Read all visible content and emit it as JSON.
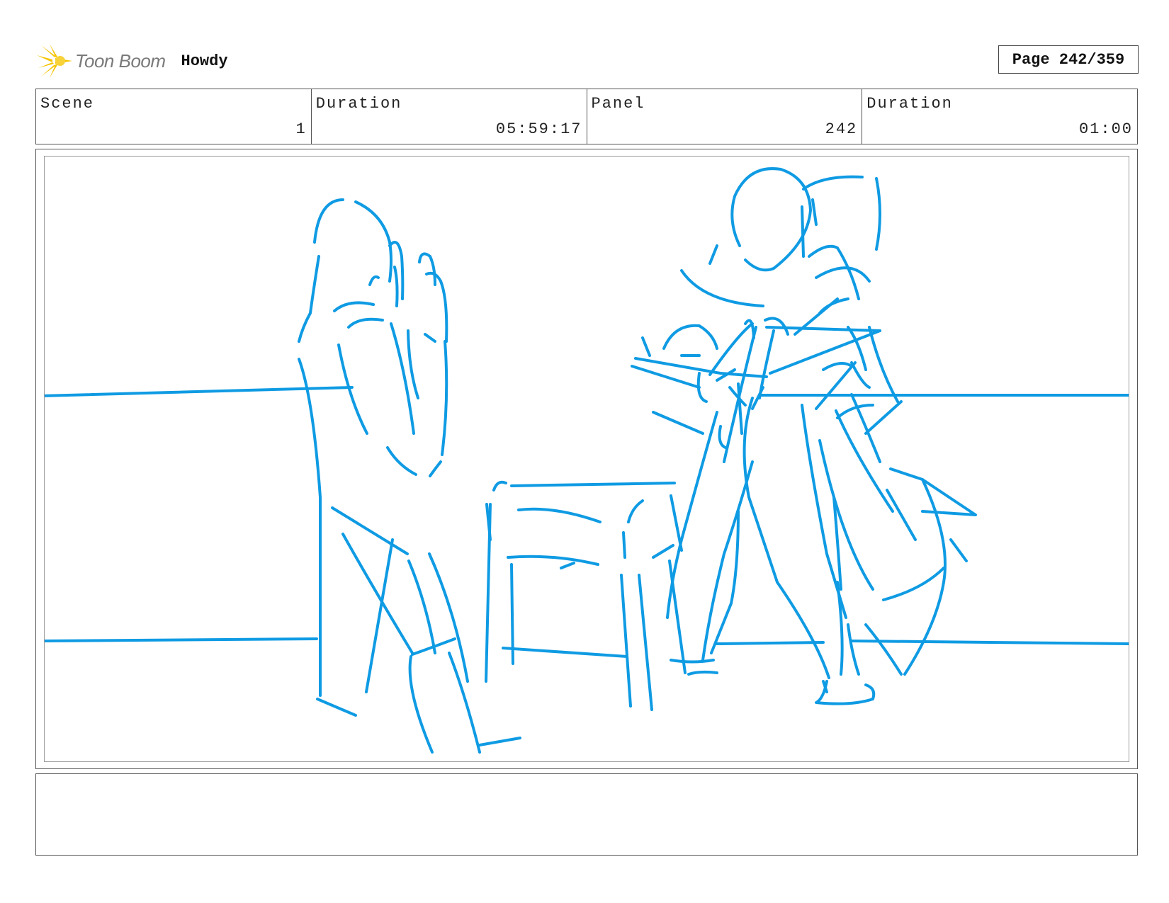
{
  "header": {
    "logo_text": "Toon Boom",
    "logo_icon": "starburst-logo-icon",
    "project_title": "Howdy",
    "page_label": "Page 242/359"
  },
  "info": {
    "scene_label": "Scene",
    "scene_value": "1",
    "scene_duration_label": "Duration",
    "scene_duration_value": "05:59:17",
    "panel_label": "Panel",
    "panel_value": "242",
    "panel_duration_label": "Duration",
    "panel_duration_value": "01:00"
  },
  "notes": {
    "text": ""
  },
  "colors": {
    "sketch": "#0f9be3",
    "logo_yellow": "#f5c400",
    "border": "#555555"
  }
}
